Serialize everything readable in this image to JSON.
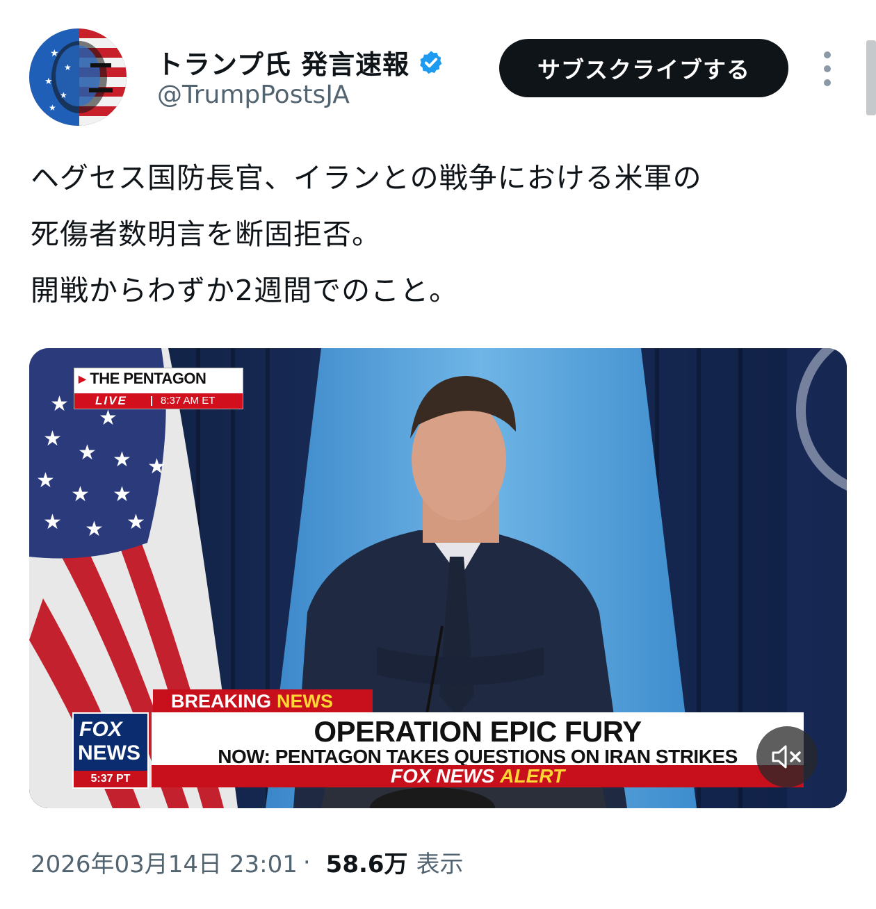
{
  "post": {
    "author_name": "トランプ氏 発言速報",
    "handle": "@TrumpPostsJA",
    "subscribe_label": "サブスクライブする",
    "text": "ヘグセス国防長官、イランとの戦争における米軍の\n死傷者数明言を断固拒否。\n開戦からわずか2週間でのこと。",
    "timestamp": "2026年03月14日 23:01",
    "separator": "·",
    "views": "58.6万",
    "views_label": "表示"
  },
  "video": {
    "location": "THE PENTAGON",
    "live": "LIVE",
    "live_time": "8:37 AM ET",
    "breaking": "BREAKING",
    "breaking_news": "NEWS",
    "network_top": "FOX",
    "network_bottom": "NEWS",
    "network_time": "5:37 PT",
    "headline": "OPERATION EPIC FURY",
    "subhead": "NOW: PENTAGON TAKES QUESTIONS ON IRAN STRIKES",
    "alert_network": "FOX NEWS",
    "alert_word": "ALERT",
    "mute_icon": "speaker-muted-icon"
  },
  "colors": {
    "accent_dark": "#0f1419",
    "muted_text": "#536471",
    "verified_blue": "#1d9bf0",
    "fox_red": "#c8101d",
    "fox_yellow": "#ffd633"
  }
}
